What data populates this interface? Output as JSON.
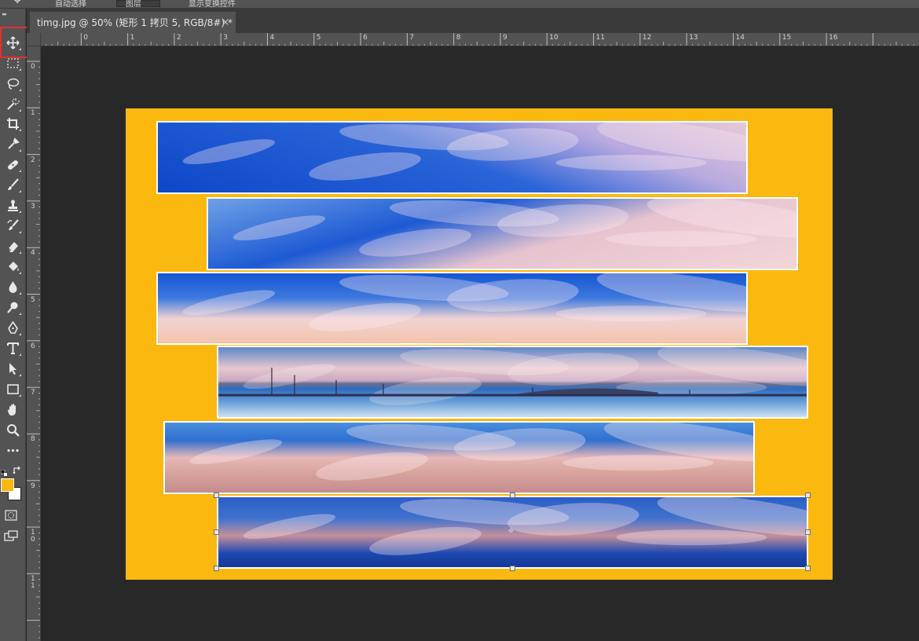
{
  "options_bar": {
    "items": [
      "自动选择",
      "图层",
      "显示变换控件"
    ]
  },
  "toolbox": {
    "tools": [
      {
        "name": "move-tool",
        "icon": "move-icon"
      },
      {
        "name": "marquee-tool",
        "icon": "rect-marquee-icon"
      },
      {
        "name": "lasso-tool",
        "icon": "lasso-icon"
      },
      {
        "name": "magic-wand-tool",
        "icon": "magic-wand-icon"
      },
      {
        "name": "crop-tool",
        "icon": "crop-icon"
      },
      {
        "name": "eyedropper-tool",
        "icon": "eyedropper-icon"
      },
      {
        "name": "healing-brush-tool",
        "icon": "bandage-icon"
      },
      {
        "name": "brush-tool",
        "icon": "brush-icon"
      },
      {
        "name": "clone-stamp-tool",
        "icon": "stamp-icon"
      },
      {
        "name": "history-brush-tool",
        "icon": "history-brush-icon"
      },
      {
        "name": "eraser-tool",
        "icon": "eraser-icon"
      },
      {
        "name": "paint-bucket-tool",
        "icon": "paint-bucket-icon"
      },
      {
        "name": "blur-tool",
        "icon": "drop-icon"
      },
      {
        "name": "dodge-tool",
        "icon": "dodge-icon"
      },
      {
        "name": "pen-tool",
        "icon": "pen-icon"
      },
      {
        "name": "type-tool",
        "icon": "type-icon"
      },
      {
        "name": "path-selection-tool",
        "icon": "arrow-icon"
      },
      {
        "name": "rectangle-tool",
        "icon": "rectangle-icon"
      },
      {
        "name": "hand-tool",
        "icon": "hand-icon"
      },
      {
        "name": "zoom-tool",
        "icon": "magnifier-icon"
      },
      {
        "name": "more-tools",
        "icon": "ellipsis-icon"
      }
    ],
    "foreground_color": "#fbb80f",
    "background_color": "#ffffff"
  },
  "document": {
    "tab_title": "timg.jpg @ 50% (矩形 1 拷贝 5, RGB/8#) *",
    "close_glyph": "×",
    "canvas_color": "#fbb80f"
  },
  "rulers": {
    "horizontal": [
      "1",
      "0",
      "1",
      "2",
      "3",
      "4",
      "5",
      "6",
      "7",
      "8",
      "9",
      "10",
      "11",
      "12",
      "13",
      "14",
      "15",
      "16"
    ],
    "vertical": [
      "1",
      "0",
      "1",
      "2",
      "3",
      "4",
      "5",
      "6",
      "7",
      "8",
      "9",
      "10",
      "11"
    ]
  },
  "layers": {
    "strip_count": 6,
    "selected_strip": 6
  }
}
